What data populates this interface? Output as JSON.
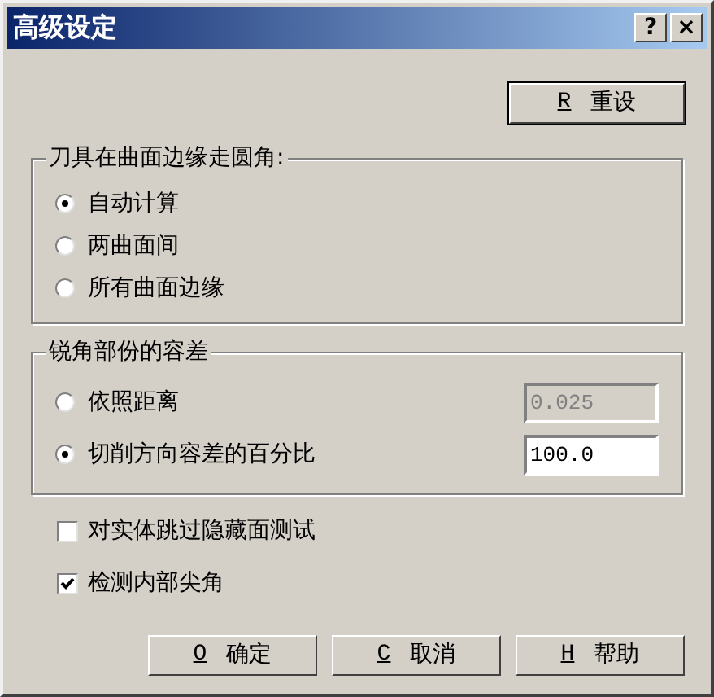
{
  "window": {
    "title": "高级设定",
    "title_buttons": [
      "?",
      "×"
    ]
  },
  "reset_button": {
    "mnemonic": "R",
    "label": "重设"
  },
  "corner_group": {
    "title": "刀具在曲面边缘走圆角:",
    "options": [
      {
        "label": "自动计算",
        "selected": true
      },
      {
        "label": "两曲面间",
        "selected": false
      },
      {
        "label": "所有曲面边缘",
        "selected": false
      }
    ]
  },
  "tolerance_group": {
    "title": "锐角部份的容差",
    "options": [
      {
        "label": "依照距离",
        "selected": false,
        "value": "0.025",
        "disabled": true
      },
      {
        "label": "切削方向容差的百分比",
        "selected": true,
        "value": "100.0",
        "disabled": false
      }
    ]
  },
  "checkboxes": [
    {
      "label": "对实体跳过隐藏面测试",
      "checked": false
    },
    {
      "label": "检测内部尖角",
      "checked": true
    }
  ],
  "buttons": [
    {
      "mnemonic": "O",
      "label": "确定"
    },
    {
      "mnemonic": "C",
      "label": "取消"
    },
    {
      "mnemonic": "H",
      "label": "帮助"
    }
  ]
}
